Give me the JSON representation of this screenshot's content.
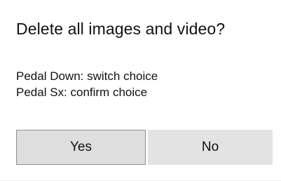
{
  "dialog": {
    "title": "Delete all images and video?",
    "instructions": [
      "Pedal Down: switch choice",
      "Pedal Sx: confirm choice"
    ],
    "buttons": {
      "yes_label": "Yes",
      "no_label": "No"
    }
  }
}
